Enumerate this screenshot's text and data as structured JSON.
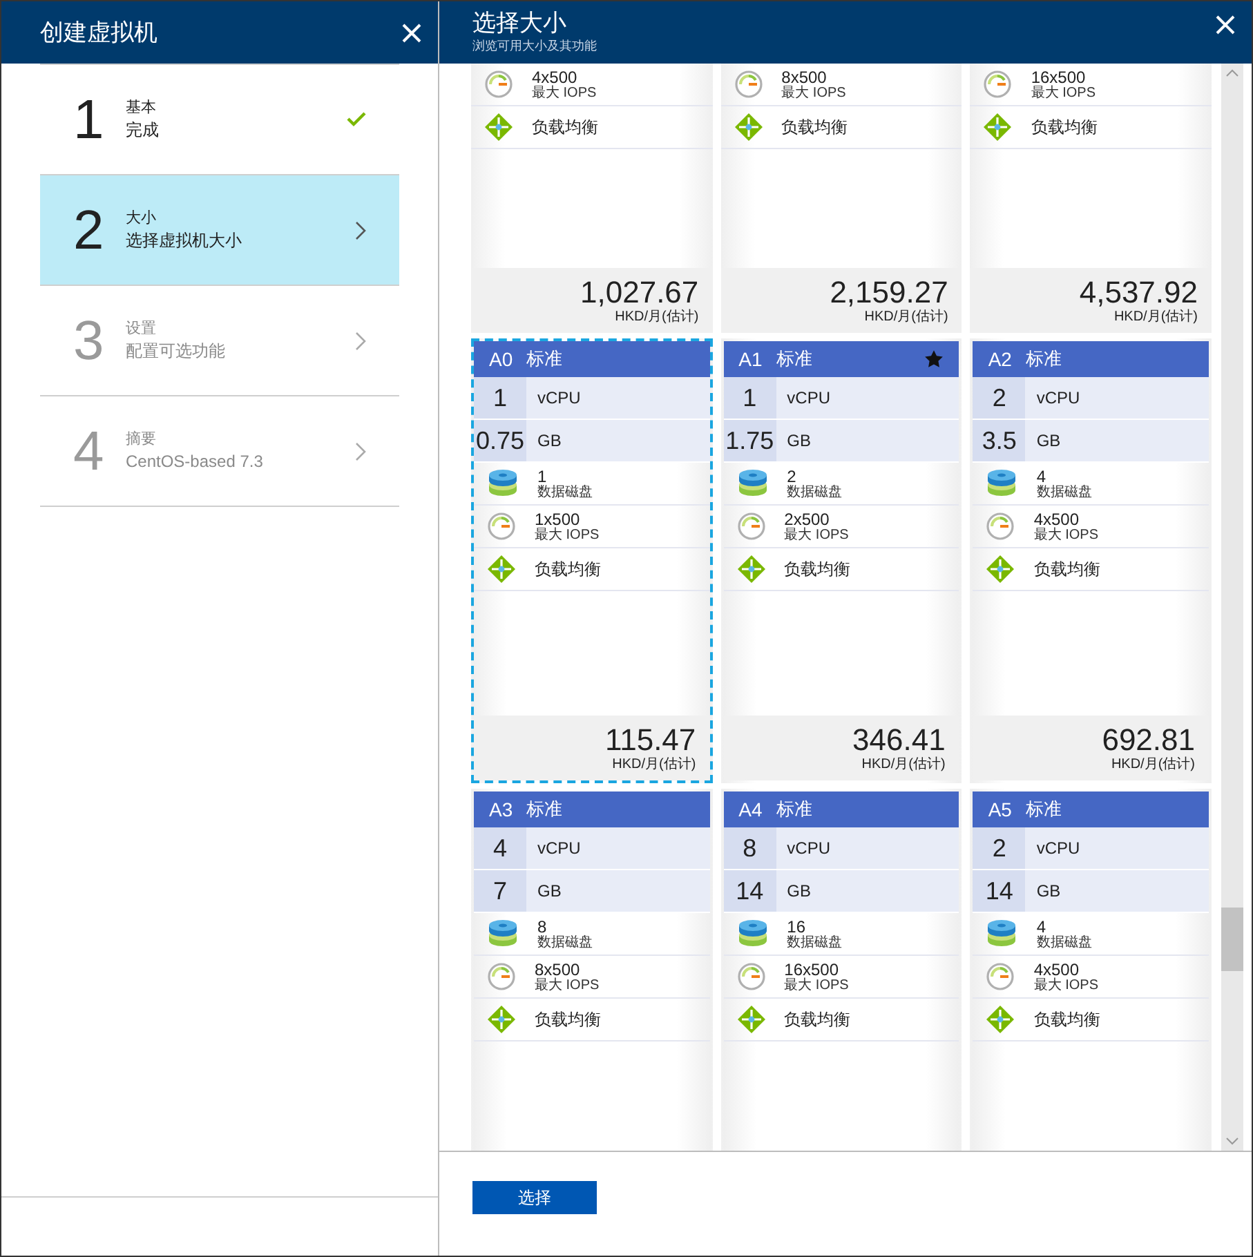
{
  "left_panel": {
    "title": "创建虚拟机",
    "steps": [
      {
        "number": "1",
        "title": "基本",
        "subtitle": "完成",
        "kind": "done",
        "selected": false
      },
      {
        "number": "2",
        "title": "大小",
        "subtitle": "选择虚拟机大小",
        "kind": "active",
        "selected": true
      },
      {
        "number": "3",
        "title": "设置",
        "subtitle": "配置可选功能",
        "kind": "todo",
        "selected": false
      },
      {
        "number": "4",
        "title": "摘要",
        "subtitle": "CentOS-based 7.3",
        "kind": "todo",
        "selected": false
      }
    ]
  },
  "right_panel": {
    "title": "选择大小",
    "subtitle": "浏览可用大小及其功能",
    "cards": [
      {
        "kind": "partial",
        "iops": "4x500",
        "iops_label": "最大 IOPS",
        "lb": "负载均衡",
        "price": "1,027.67",
        "unit": "HKD/月(估计)"
      },
      {
        "kind": "partial",
        "iops": "8x500",
        "iops_label": "最大 IOPS",
        "lb": "负载均衡",
        "price": "2,159.27",
        "unit": "HKD/月(估计)"
      },
      {
        "kind": "partial",
        "iops": "16x500",
        "iops_label": "最大 IOPS",
        "lb": "负载均衡",
        "price": "4,537.92",
        "unit": "HKD/月(估计)"
      },
      {
        "kind": "full",
        "name": "A0",
        "tier": "标准",
        "starred": false,
        "selected": true,
        "vcpu": "1",
        "vcpu_label": "vCPU",
        "mem": "0.75",
        "mem_label": "GB",
        "disks": "1",
        "disks_label": "数据磁盘",
        "iops": "1x500",
        "iops_label": "最大 IOPS",
        "lb": "负载均衡",
        "price": "115.47",
        "unit": "HKD/月(估计)"
      },
      {
        "kind": "full",
        "name": "A1",
        "tier": "标准",
        "starred": true,
        "selected": false,
        "vcpu": "1",
        "vcpu_label": "vCPU",
        "mem": "1.75",
        "mem_label": "GB",
        "disks": "2",
        "disks_label": "数据磁盘",
        "iops": "2x500",
        "iops_label": "最大 IOPS",
        "lb": "负载均衡",
        "price": "346.41",
        "unit": "HKD/月(估计)"
      },
      {
        "kind": "full",
        "name": "A2",
        "tier": "标准",
        "starred": false,
        "selected": false,
        "vcpu": "2",
        "vcpu_label": "vCPU",
        "mem": "3.5",
        "mem_label": "GB",
        "disks": "4",
        "disks_label": "数据磁盘",
        "iops": "4x500",
        "iops_label": "最大 IOPS",
        "lb": "负载均衡",
        "price": "692.81",
        "unit": "HKD/月(估计)"
      },
      {
        "kind": "full",
        "name": "A3",
        "tier": "标准",
        "starred": false,
        "selected": false,
        "vcpu": "4",
        "vcpu_label": "vCPU",
        "mem": "7",
        "mem_label": "GB",
        "disks": "8",
        "disks_label": "数据磁盘",
        "iops": "8x500",
        "iops_label": "最大 IOPS",
        "lb": "负载均衡"
      },
      {
        "kind": "full",
        "name": "A4",
        "tier": "标准",
        "starred": false,
        "selected": false,
        "vcpu": "8",
        "vcpu_label": "vCPU",
        "mem": "14",
        "mem_label": "GB",
        "disks": "16",
        "disks_label": "数据磁盘",
        "iops": "16x500",
        "iops_label": "最大 IOPS",
        "lb": "负载均衡"
      },
      {
        "kind": "full",
        "name": "A5",
        "tier": "标准",
        "starred": false,
        "selected": false,
        "vcpu": "2",
        "vcpu_label": "vCPU",
        "mem": "14",
        "mem_label": "GB",
        "disks": "4",
        "disks_label": "数据磁盘",
        "iops": "4x500",
        "iops_label": "最大 IOPS",
        "lb": "负载均衡"
      }
    ],
    "select_button": "选择"
  }
}
